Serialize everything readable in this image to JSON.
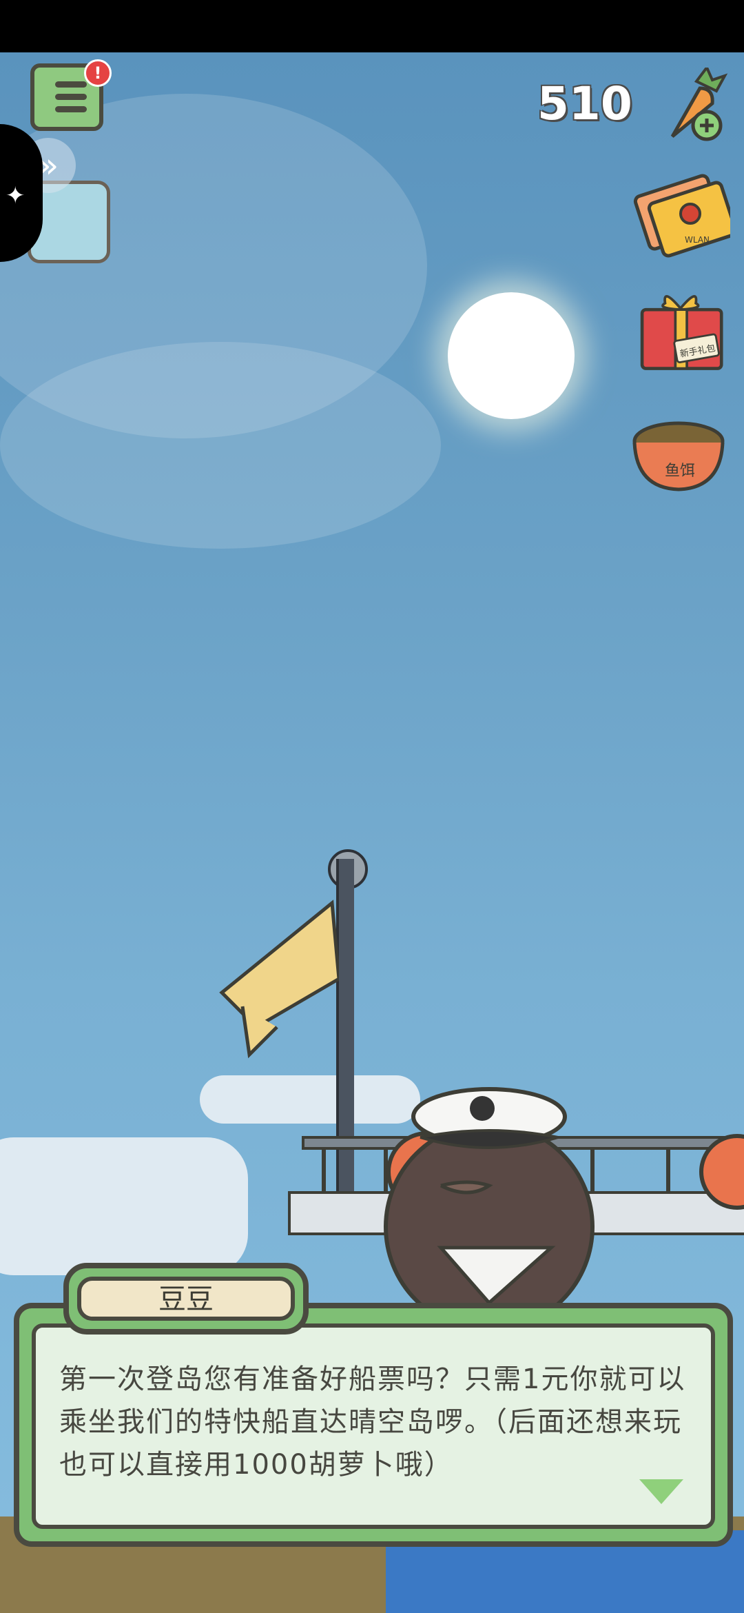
{
  "hud": {
    "carrot_count": "510",
    "notification_badge": "!"
  },
  "right_icons": {
    "gift_label": "新手礼包",
    "bowl_label": "鱼饵",
    "ticket_label": "WLAN"
  },
  "dialog": {
    "speaker": "豆豆",
    "text": "第一次登岛您有准备好船票吗？只需1元你就可以乘坐我们的特快船直达晴空岛啰。（后面还想来玩也可以直接用1000胡萝卜哦）"
  },
  "colors": {
    "dialog_green": "#7fbf75",
    "sky": "#6ba2c7",
    "badge_red": "#e54343"
  }
}
